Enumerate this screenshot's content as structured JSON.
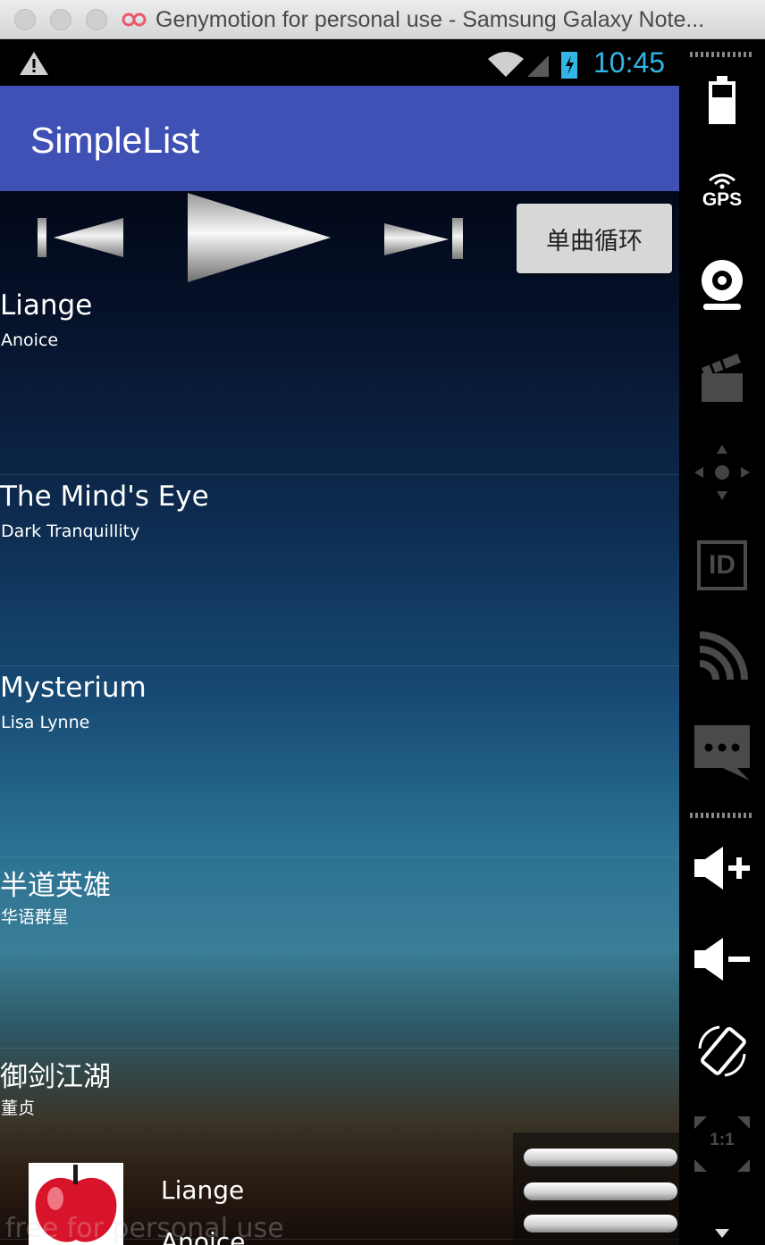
{
  "window": {
    "title": "Genymotion for personal use - Samsung Galaxy Note..."
  },
  "statusbar": {
    "time": "10:45",
    "clock_color": "#33b5e5"
  },
  "app": {
    "title": "SimpleList",
    "accent": "#3f51b5"
  },
  "controls": {
    "mode_label": "单曲循环"
  },
  "songs": [
    {
      "title": "Liange",
      "artist": "Anoice"
    },
    {
      "title": "The Mind's Eye",
      "artist": "Dark Tranquillity"
    },
    {
      "title": "Mysterium",
      "artist": "Lisa Lynne"
    },
    {
      "title": "半道英雄",
      "artist": "华语群星"
    },
    {
      "title": "御剑江湖",
      "artist": "董贞"
    }
  ],
  "now_playing": {
    "title": "Liange",
    "artist": "Anoice",
    "watermark": "free for personal use"
  },
  "sidebar": {
    "gps_label": "GPS",
    "id_label": "ID",
    "ratio_label": "1:1"
  }
}
